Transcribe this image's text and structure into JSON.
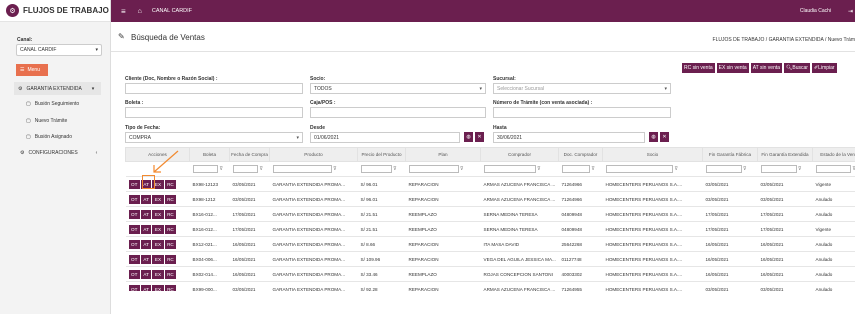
{
  "sidebar": {
    "brand": "FLUJOS DE TRABAJO",
    "canal_label": "Canal:",
    "canal_value": "CANAL CARDIF",
    "menu_button": "Menu",
    "items": [
      {
        "label": "GARANTIA EXTENDIDA"
      },
      {
        "label": "Busión Seguimiento"
      },
      {
        "label": "Nuevo Trámite"
      },
      {
        "label": "Busión Asignado"
      },
      {
        "label": "CONFIGURACIONES"
      }
    ]
  },
  "topbar": {
    "canal": "CANAL CARDIF",
    "user": "Claudia Cachi"
  },
  "page": {
    "title": "Búsqueda de Ventas",
    "breadcrumb": "FLUJOS DE TRABAJO / GARANTIA EXTENDIDA / Nuevo Trám"
  },
  "actions": [
    "RC sin venta",
    "EX sin venta",
    "AT sin venta",
    "Buscar",
    "Limpiar"
  ],
  "filters": {
    "cliente_label": "Cliente (Doc, Nombre o Razón Social) :",
    "socio_label": "Socio:",
    "socio_value": "TODOS",
    "sucursal_label": "Sucursal:",
    "sucursal_placeholder": "Seleccionar Sucursal",
    "boleta_label": "Boleta :",
    "caja_label": "Caja/POS :",
    "tramite_label": "Número de Trámite (con venta asociada) :",
    "tipo_fecha_label": "Tipo de Fecha:",
    "tipo_fecha_value": "COMPRA",
    "desde_label": "Desde",
    "desde_value": "01/06/2021",
    "hasta_label": "Hasta",
    "hasta_value": "30/06/2021"
  },
  "table": {
    "headers": [
      "Acciones",
      "Boleta",
      "Fecha de Compra",
      "Producto",
      "Precio del Producto",
      "Plan",
      "Comprador",
      "Doc. Comprador",
      "Socio",
      "Fin Garantía Fábrica",
      "Fin Garantía Extendida",
      "Estado de la Venta",
      "Fecha de Anulación"
    ],
    "action_labels": [
      "OT",
      "AT",
      "EX",
      "RC"
    ],
    "rows": [
      {
        "boleta": "BX98-12123",
        "fecha": "03/05/2021",
        "producto": "GARANTIA EXTENDIDA PROMA...",
        "precio": "S/ 96.01",
        "plan": "REPARACION",
        "comprador": "ARMAS AZUCENA FRANCISCA ...",
        "doc": "71264966",
        "socio": "HOMECENTERS PERUANOS S.A....",
        "fin_fab": "03/05/2021",
        "fin_ext": "03/05/2021",
        "estado": "Vigente"
      },
      {
        "boleta": "BX98-1212",
        "fecha": "03/05/2021",
        "producto": "GARANTIA EXTENDIDA PROMA...",
        "precio": "S/ 96.01",
        "plan": "REPARACION",
        "comprador": "ARMAS AZUCENA FRANCISCA ...",
        "doc": "71264966",
        "socio": "HOMECENTERS PERUANOS S.A....",
        "fin_fab": "03/05/2021",
        "fin_ext": "03/05/2021",
        "estado": "Anulado"
      },
      {
        "boleta": "BX16-012...",
        "fecha": "17/05/2021",
        "producto": "GARANTIA EXTENDIDA PROMA...",
        "precio": "S/ 21.51",
        "plan": "REEMPLAZO",
        "comprador": "SERNA MEDINA TERESA",
        "doc": "04809948",
        "socio": "HOMECENTERS PERUANOS S.A....",
        "fin_fab": "17/05/2021",
        "fin_ext": "17/05/2021",
        "estado": "Anulado"
      },
      {
        "boleta": "BX16-012...",
        "fecha": "17/05/2021",
        "producto": "GARANTIA EXTENDIDA PROMA...",
        "precio": "S/ 21.51",
        "plan": "REEMPLAZO",
        "comprador": "SERNA MEDINA TERESA",
        "doc": "04809948",
        "socio": "HOMECENTERS PERUANOS S.A....",
        "fin_fab": "17/05/2021",
        "fin_ext": "17/05/2021",
        "estado": "Vigente"
      },
      {
        "boleta": "BX12-021...",
        "fecha": "16/05/2021",
        "producto": "GARANTIA EXTENDIDA PROMA...",
        "precio": "S/ 8.66",
        "plan": "REPARACION",
        "comprador": "ITA MASA DAVID",
        "doc": "25642268",
        "socio": "HOMECENTERS PERUANOS S.A....",
        "fin_fab": "16/05/2021",
        "fin_ext": "16/05/2021",
        "estado": "Anulado"
      },
      {
        "boleta": "BX04-006...",
        "fecha": "16/05/2021",
        "producto": "GARANTIA EXTENDIDA PROMA...",
        "precio": "S/ 109.96",
        "plan": "REPARACION",
        "comprador": "VEGA DEL AGUILA JESSICA MA...",
        "doc": "01127748",
        "socio": "HOMECENTERS PERUANOS S.A....",
        "fin_fab": "16/05/2021",
        "fin_ext": "16/05/2021",
        "estado": "Anulado"
      },
      {
        "boleta": "BX02-014...",
        "fecha": "16/05/2021",
        "producto": "GARANTIA EXTENDIDA PROMA...",
        "precio": "S/ 33.46",
        "plan": "REEMPLAZO",
        "comprador": "ROJAS CONCEPCION SANTONI",
        "doc": "40003302",
        "socio": "HOMECENTERS PERUANOS S.A....",
        "fin_fab": "16/05/2021",
        "fin_ext": "16/05/2021",
        "estado": "Anulado"
      },
      {
        "boleta": "BX99-000...",
        "fecha": "03/05/2021",
        "producto": "GARANTIA EXTENDIDA PROMA...",
        "precio": "S/ 92.28",
        "plan": "REPARACION",
        "comprador": "ARMAS AZUCENA FRANCISCA ...",
        "doc": "71264955",
        "socio": "HOMECENTERS PERUANOS S.A....",
        "fin_fab": "03/05/2021",
        "fin_ext": "03/05/2021",
        "estado": "Anulado"
      }
    ]
  },
  "colors": {
    "primary": "#6b1f4f",
    "accent": "#e8704e",
    "highlight": "#f28a30"
  }
}
